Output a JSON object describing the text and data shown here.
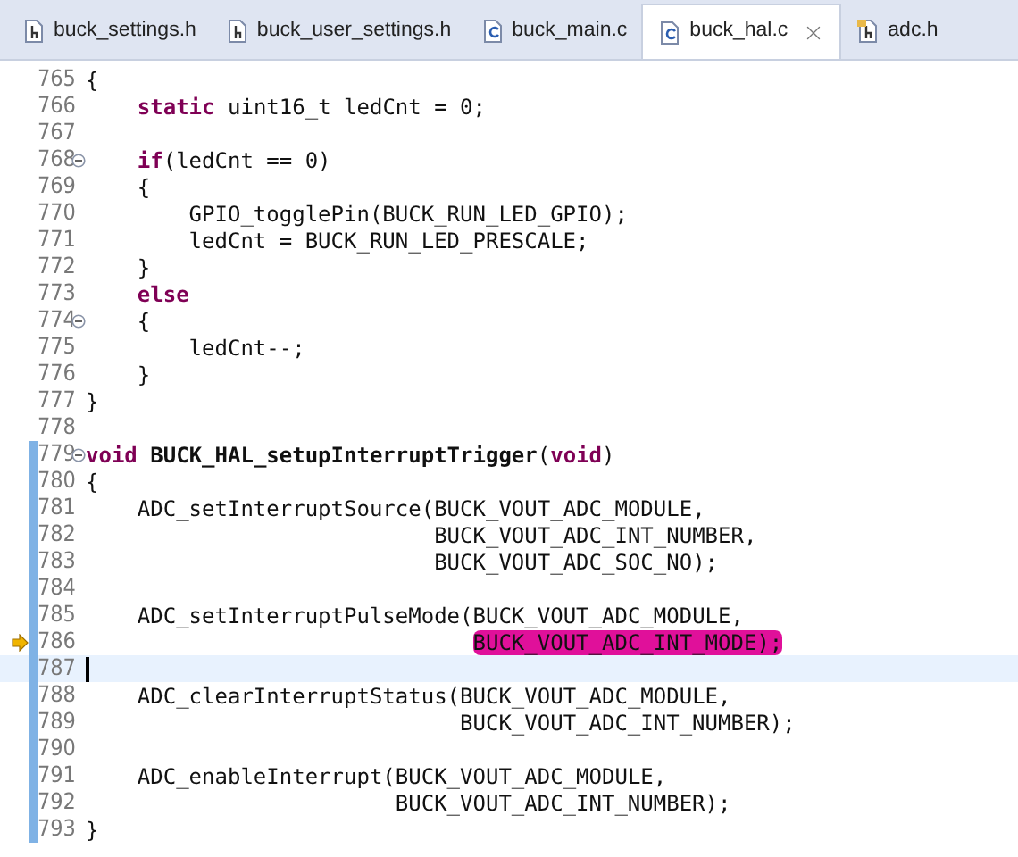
{
  "tabs": [
    {
      "label": "buck_settings.h",
      "kind": "header",
      "selected": false
    },
    {
      "label": "buck_user_settings.h",
      "kind": "header",
      "selected": false
    },
    {
      "label": "buck_main.c",
      "kind": "source",
      "selected": false
    },
    {
      "label": "buck_hal.c",
      "kind": "source",
      "selected": true
    },
    {
      "label": "adc.h",
      "kind": "linked_header",
      "selected": false
    }
  ],
  "lines": [
    {
      "number": "765",
      "range": false,
      "fold": false,
      "current": false,
      "arrow": false,
      "code": [
        {
          "kind": "plain",
          "text": "{"
        }
      ]
    },
    {
      "number": "766",
      "range": false,
      "fold": false,
      "current": false,
      "arrow": false,
      "code": [
        {
          "kind": "keyword",
          "text": "    static"
        },
        {
          "kind": "plain",
          "text": " uint16_t ledCnt = 0;"
        }
      ]
    },
    {
      "number": "767",
      "range": false,
      "fold": false,
      "current": false,
      "arrow": false
    },
    {
      "number": "768",
      "range": false,
      "fold": true,
      "current": false,
      "arrow": false,
      "code": [
        {
          "kind": "keyword",
          "text": "    if"
        },
        {
          "kind": "plain",
          "text": "(ledCnt == 0)"
        }
      ]
    },
    {
      "number": "769",
      "range": false,
      "fold": false,
      "current": false,
      "arrow": false,
      "code": [
        {
          "kind": "plain",
          "text": "    {"
        }
      ]
    },
    {
      "number": "770",
      "range": false,
      "fold": false,
      "current": false,
      "arrow": false,
      "code": [
        {
          "kind": "plain",
          "text": "        GPIO_togglePin(BUCK_RUN_LED_GPIO);"
        }
      ]
    },
    {
      "number": "771",
      "range": false,
      "fold": false,
      "current": false,
      "arrow": false,
      "code": [
        {
          "kind": "plain",
          "text": "        ledCnt = BUCK_RUN_LED_PRESCALE;"
        }
      ]
    },
    {
      "number": "772",
      "range": false,
      "fold": false,
      "current": false,
      "arrow": false,
      "code": [
        {
          "kind": "plain",
          "text": "    }"
        }
      ]
    },
    {
      "number": "773",
      "range": false,
      "fold": false,
      "current": false,
      "arrow": false,
      "code": [
        {
          "kind": "keyword",
          "text": "    else"
        }
      ]
    },
    {
      "number": "774",
      "range": false,
      "fold": true,
      "current": false,
      "arrow": false,
      "code": [
        {
          "kind": "plain",
          "text": "    {"
        }
      ]
    },
    {
      "number": "775",
      "range": false,
      "fold": false,
      "current": false,
      "arrow": false,
      "code": [
        {
          "kind": "plain",
          "text": "        ledCnt--;"
        }
      ]
    },
    {
      "number": "776",
      "range": false,
      "fold": false,
      "current": false,
      "arrow": false,
      "code": [
        {
          "kind": "plain",
          "text": "    }"
        }
      ]
    },
    {
      "number": "777",
      "range": false,
      "fold": false,
      "current": false,
      "arrow": false,
      "code": [
        {
          "kind": "plain",
          "text": "}"
        }
      ]
    },
    {
      "number": "778",
      "range": false,
      "fold": false,
      "current": false,
      "arrow": false
    },
    {
      "number": "779",
      "range": true,
      "fold": true,
      "current": false,
      "arrow": false,
      "code": [
        {
          "kind": "keyword",
          "text": "void"
        },
        {
          "kind": "function",
          "text": " BUCK_HAL_setupInterruptTrigger"
        },
        {
          "kind": "plain",
          "text": "("
        },
        {
          "kind": "keyword",
          "text": "void"
        },
        {
          "kind": "plain",
          "text": ")"
        }
      ]
    },
    {
      "number": "780",
      "range": true,
      "fold": false,
      "current": false,
      "arrow": false,
      "code": [
        {
          "kind": "plain",
          "text": "{"
        }
      ]
    },
    {
      "number": "781",
      "range": true,
      "fold": false,
      "current": false,
      "arrow": false,
      "code": [
        {
          "kind": "plain",
          "text": "    ADC_setInterruptSource(BUCK_VOUT_ADC_MODULE,"
        }
      ]
    },
    {
      "number": "782",
      "range": true,
      "fold": false,
      "current": false,
      "arrow": false,
      "code": [
        {
          "kind": "plain",
          "text": "                           BUCK_VOUT_ADC_INT_NUMBER,"
        }
      ]
    },
    {
      "number": "783",
      "range": true,
      "fold": false,
      "current": false,
      "arrow": false,
      "code": [
        {
          "kind": "plain",
          "text": "                           BUCK_VOUT_ADC_SOC_NO);"
        }
      ]
    },
    {
      "number": "784",
      "range": true,
      "fold": false,
      "current": false,
      "arrow": false
    },
    {
      "number": "785",
      "range": true,
      "fold": false,
      "current": false,
      "arrow": false,
      "code": [
        {
          "kind": "plain",
          "text": "    ADC_setInterruptPulseMode(BUCK_VOUT_ADC_MODULE,"
        }
      ]
    },
    {
      "number": "786",
      "range": true,
      "fold": false,
      "current": false,
      "arrow": true,
      "code": [
        {
          "kind": "marked",
          "text": "                              BUCK_VOUT_ADC_INT_MODE);"
        }
      ]
    },
    {
      "number": "787",
      "range": true,
      "fold": false,
      "current": true,
      "arrow": false
    },
    {
      "number": "788",
      "range": true,
      "fold": false,
      "current": false,
      "arrow": false,
      "code": [
        {
          "kind": "plain",
          "text": "    ADC_clearInterruptStatus(BUCK_VOUT_ADC_MODULE,"
        }
      ]
    },
    {
      "number": "789",
      "range": true,
      "fold": false,
      "current": false,
      "arrow": false,
      "code": [
        {
          "kind": "plain",
          "text": "                             BUCK_VOUT_ADC_INT_NUMBER);"
        }
      ]
    },
    {
      "number": "790",
      "range": true,
      "fold": false,
      "current": false,
      "arrow": false
    },
    {
      "number": "791",
      "range": true,
      "fold": false,
      "current": false,
      "arrow": false,
      "code": [
        {
          "kind": "plain",
          "text": "    ADC_enableInterrupt(BUCK_VOUT_ADC_MODULE,"
        }
      ]
    },
    {
      "number": "792",
      "range": true,
      "fold": false,
      "current": false,
      "arrow": false,
      "code": [
        {
          "kind": "plain",
          "text": "                        BUCK_VOUT_ADC_INT_NUMBER);"
        }
      ]
    },
    {
      "number": "793",
      "range": true,
      "fold": false,
      "current": false,
      "arrow": false,
      "code": [
        {
          "kind": "plain",
          "text": "}"
        }
      ]
    }
  ]
}
